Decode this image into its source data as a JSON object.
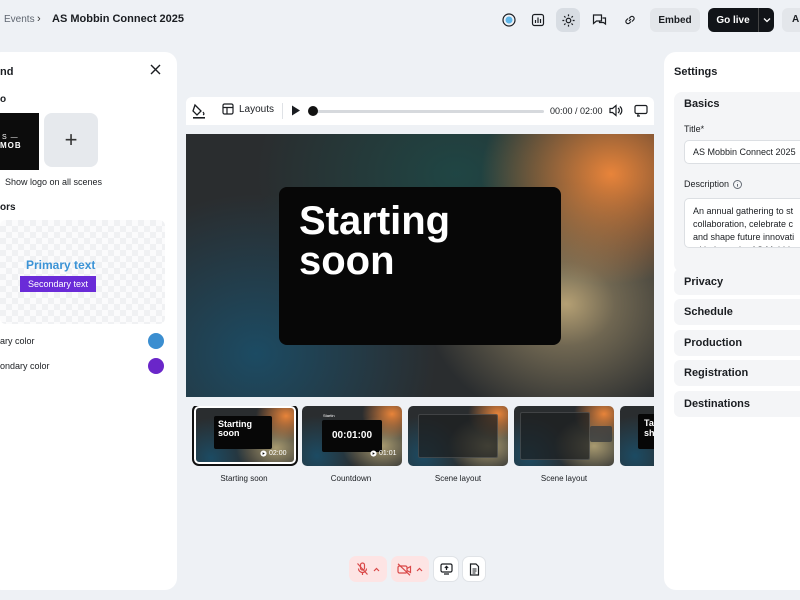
{
  "breadcrumb": {
    "parent": "Events",
    "separator": "›",
    "current": "AS Mobbin Connect 2025"
  },
  "topbar": {
    "embed_label": "Embed",
    "golive_label": "Go live",
    "cut_label": "A"
  },
  "brand_panel": {
    "title": "nd",
    "logo_label": "o",
    "logo_text_top": "S —",
    "logo_text_bottom": "MOB",
    "add_symbol": "+",
    "show_logo_label": "Show logo on all scenes",
    "colors_label": "ors",
    "preview_primary": "Primary text",
    "preview_secondary": "Secondary text",
    "primary_color_label": "ary color",
    "secondary_color_label": "ondary color",
    "primary_color": "#3b8ed0",
    "secondary_color": "#6a26c9"
  },
  "player": {
    "layouts_label": "Layouts",
    "time": "00:00 / 02:00",
    "progress": 0.0
  },
  "stage": {
    "line1": "Starting",
    "line2": "soon"
  },
  "scenes": [
    {
      "name": "Starting soon",
      "title1": "Starting",
      "title2": "soon",
      "duration": "02:00"
    },
    {
      "name": "Countdown",
      "small_title": "Startin",
      "countdown": "00:01:00",
      "duration": "01:01"
    },
    {
      "name": "Scene layout"
    },
    {
      "name": "Scene layout"
    },
    {
      "title1": "Ta",
      "title2": "sh"
    }
  ],
  "settings": {
    "title": "Settings",
    "basics_label": "Basics",
    "title_label": "Title",
    "required_mark": "*",
    "title_value": "AS Mobbin Connect 2025",
    "description_label": "Description",
    "description_value": "An annual gathering to st collaboration, celebrate c and shape future innovati with the entire AS Mobbin",
    "sections": [
      "Privacy",
      "Schedule",
      "Production",
      "Registration",
      "Destinations"
    ]
  }
}
